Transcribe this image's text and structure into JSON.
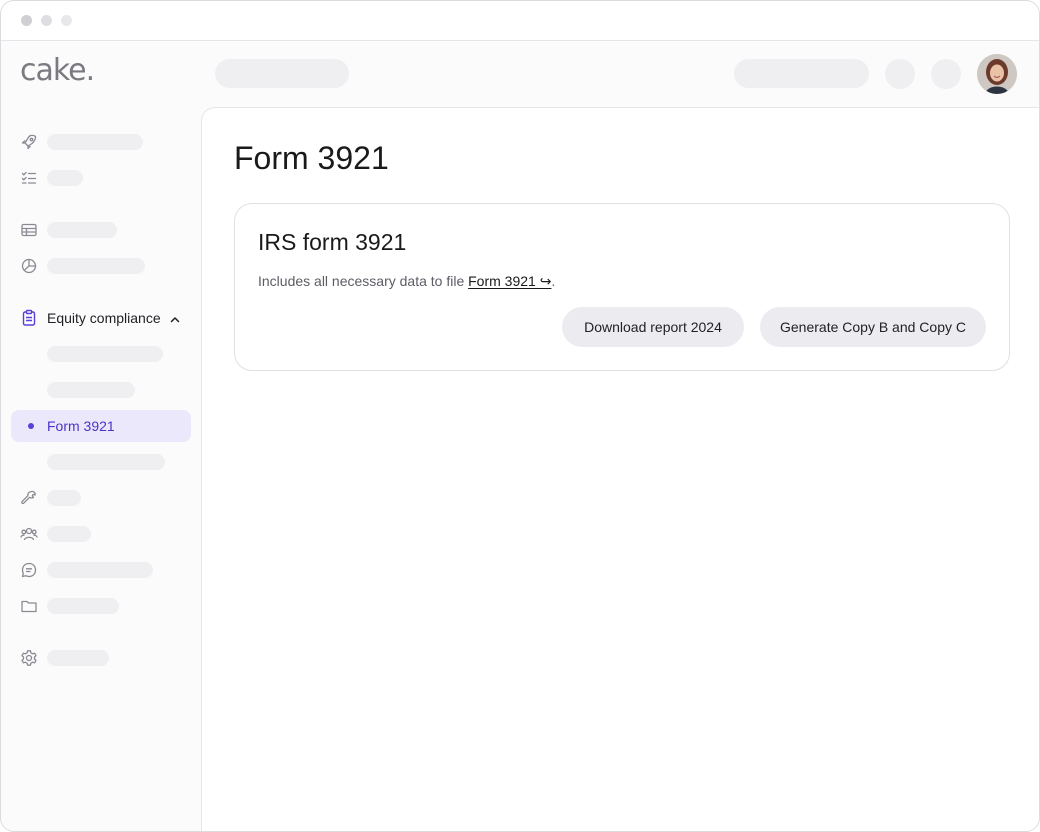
{
  "app": {
    "logo_text": "cake.",
    "accent_color": "#5b3fd6",
    "active_bg_color": "#ece8fb"
  },
  "sidebar": {
    "group": {
      "label": "Equity compliance",
      "icon": "clipboard-icon",
      "expanded": true
    },
    "active_item": {
      "label": "Form 3921"
    },
    "icons": [
      "rocket-icon",
      "checklist-icon",
      "table-icon",
      "pie-chart-icon",
      "clipboard-icon",
      "wrench-icon",
      "users-icon",
      "chat-icon",
      "folder-icon",
      "gear-icon"
    ]
  },
  "main": {
    "page_title": "Form 3921",
    "card": {
      "title": "IRS form 3921",
      "description": "Includes all necessary data to file ",
      "link_text": "Form 3921 ↪",
      "description_end": ".",
      "buttons": {
        "download": "Download report 2024",
        "generate": "Generate Copy B and Copy C"
      }
    }
  }
}
